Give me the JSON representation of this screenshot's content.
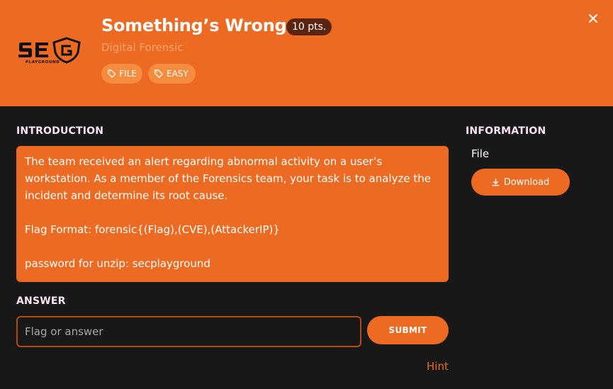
{
  "challenge": {
    "title": "Something’s Wrong",
    "points": "10 pts.",
    "category": "Digital Forensic",
    "tags": [
      "FILE",
      "EASY"
    ],
    "logo_text": "SEC",
    "logo_subtext": "PLAYGROUND"
  },
  "introduction": {
    "heading": "INTRODUCTION",
    "paragraph1": "The team received an alert regarding abnormal activity on a user’s workstation. As a member of the Forensics team, your task is to analyze the incident and determine its root cause.",
    "flag_format": "Flag Format: forensic{(Flag),(CVE),(AttackerIP)}",
    "password": "password for unzip: secplayground"
  },
  "answer": {
    "heading": "ANSWER",
    "placeholder": "Flag or answer",
    "submit_label": "SUBMIT",
    "hint_label": "Hint"
  },
  "information": {
    "heading": "INFORMATION",
    "file_label": "File",
    "download_label": "Download"
  },
  "colors": {
    "accent": "#ec6a22",
    "background": "#181818",
    "points_badge": "#5a2410",
    "tag": "#f68c3f"
  },
  "icons": {
    "close": "close-icon",
    "tag": "tag-icon",
    "download": "download-icon"
  }
}
